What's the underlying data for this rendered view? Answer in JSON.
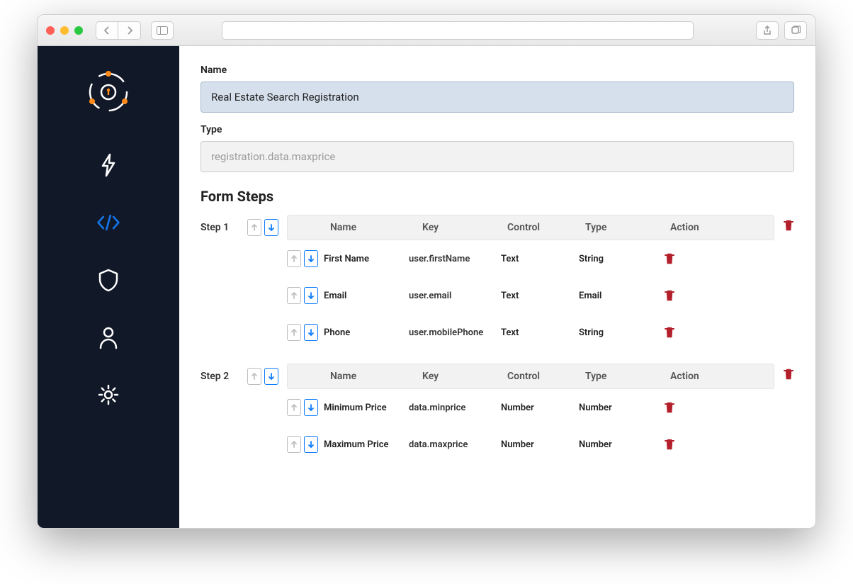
{
  "form": {
    "nameLabel": "Name",
    "nameValue": "Real Estate Search Registration",
    "typeLabel": "Type",
    "typePlaceholder": "registration.data.maxprice"
  },
  "sectionTitle": "Form Steps",
  "columns": {
    "name": "Name",
    "key": "Key",
    "control": "Control",
    "type": "Type",
    "action": "Action"
  },
  "steps": [
    {
      "label": "Step 1",
      "rows": [
        {
          "name": "First Name",
          "key": "user.firstName",
          "control": "Text",
          "type": "String"
        },
        {
          "name": "Email",
          "key": "user.email",
          "control": "Text",
          "type": "Email"
        },
        {
          "name": "Phone",
          "key": "user.mobilePhone",
          "control": "Text",
          "type": "String"
        }
      ]
    },
    {
      "label": "Step 2",
      "rows": [
        {
          "name": "Minimum Price",
          "key": "data.minprice",
          "control": "Number",
          "type": "Number"
        },
        {
          "name": "Maximum Price",
          "key": "data.maxprice",
          "control": "Number",
          "type": "Number"
        }
      ]
    }
  ]
}
